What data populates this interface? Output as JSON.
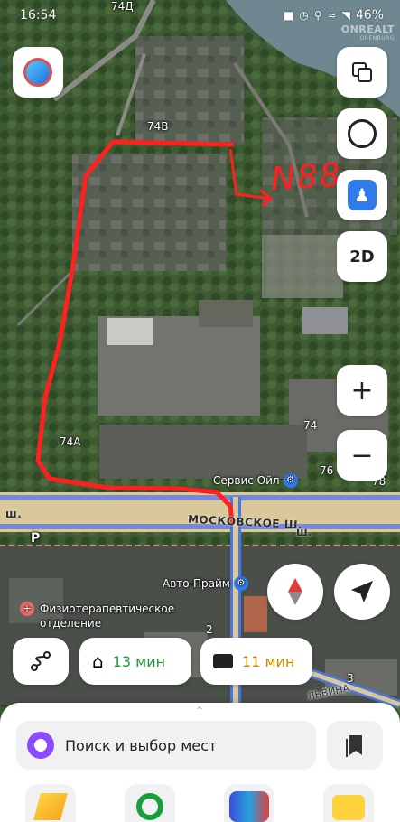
{
  "status_bar": {
    "time": "16:54",
    "battery": "46%"
  },
  "watermark": {
    "brand": "ONREALT",
    "sub": "ORENBURG"
  },
  "map": {
    "labels": {
      "house_74d": "74Д",
      "house_74v": "74В",
      "house_74a": "74А",
      "house_74": "74",
      "house_76": "76",
      "house_78": "78",
      "house_2": "2",
      "house_3": "3",
      "highway_left": "ш.",
      "highway": "МОСКОВСКОЕ Ш.",
      "highway_right": "ш."
    },
    "handwriting": "N88",
    "pois": {
      "service_oil": "Сервис Ойл",
      "auto_prime": "Авто-Прайм",
      "physio_line1": "Физиотерапевтическое",
      "physio_line2": "отделение",
      "street_fragment": "ЛЬВИНА"
    }
  },
  "controls": {
    "layers_button": "layers-icon",
    "alice_button": "alice-icon",
    "transit_button": "person-icon",
    "view_mode": "2D",
    "zoom_in": "+",
    "zoom_out": "−"
  },
  "shortcuts": {
    "home_time": "13 мин",
    "work_time": "11 мин",
    "home_color": "#1a9e3a",
    "work_color": "#d08a00"
  },
  "sheet": {
    "search_placeholder": "Поиск и выбор мест"
  },
  "colors": {
    "route": "#ff2020",
    "accent": "#8a4cff",
    "road_blue": "#4a78e0"
  }
}
